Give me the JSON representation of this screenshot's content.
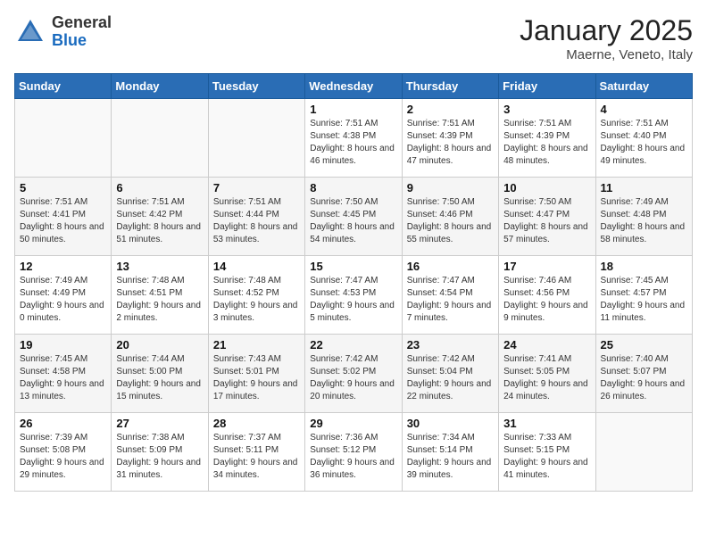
{
  "header": {
    "logo_general": "General",
    "logo_blue": "Blue",
    "title": "January 2025",
    "subtitle": "Maerne, Veneto, Italy"
  },
  "days_of_week": [
    "Sunday",
    "Monday",
    "Tuesday",
    "Wednesday",
    "Thursday",
    "Friday",
    "Saturday"
  ],
  "weeks": [
    [
      {
        "num": "",
        "sunrise": "",
        "sunset": "",
        "daylight": ""
      },
      {
        "num": "",
        "sunrise": "",
        "sunset": "",
        "daylight": ""
      },
      {
        "num": "",
        "sunrise": "",
        "sunset": "",
        "daylight": ""
      },
      {
        "num": "1",
        "sunrise": "Sunrise: 7:51 AM",
        "sunset": "Sunset: 4:38 PM",
        "daylight": "Daylight: 8 hours and 46 minutes."
      },
      {
        "num": "2",
        "sunrise": "Sunrise: 7:51 AM",
        "sunset": "Sunset: 4:39 PM",
        "daylight": "Daylight: 8 hours and 47 minutes."
      },
      {
        "num": "3",
        "sunrise": "Sunrise: 7:51 AM",
        "sunset": "Sunset: 4:39 PM",
        "daylight": "Daylight: 8 hours and 48 minutes."
      },
      {
        "num": "4",
        "sunrise": "Sunrise: 7:51 AM",
        "sunset": "Sunset: 4:40 PM",
        "daylight": "Daylight: 8 hours and 49 minutes."
      }
    ],
    [
      {
        "num": "5",
        "sunrise": "Sunrise: 7:51 AM",
        "sunset": "Sunset: 4:41 PM",
        "daylight": "Daylight: 8 hours and 50 minutes."
      },
      {
        "num": "6",
        "sunrise": "Sunrise: 7:51 AM",
        "sunset": "Sunset: 4:42 PM",
        "daylight": "Daylight: 8 hours and 51 minutes."
      },
      {
        "num": "7",
        "sunrise": "Sunrise: 7:51 AM",
        "sunset": "Sunset: 4:44 PM",
        "daylight": "Daylight: 8 hours and 53 minutes."
      },
      {
        "num": "8",
        "sunrise": "Sunrise: 7:50 AM",
        "sunset": "Sunset: 4:45 PM",
        "daylight": "Daylight: 8 hours and 54 minutes."
      },
      {
        "num": "9",
        "sunrise": "Sunrise: 7:50 AM",
        "sunset": "Sunset: 4:46 PM",
        "daylight": "Daylight: 8 hours and 55 minutes."
      },
      {
        "num": "10",
        "sunrise": "Sunrise: 7:50 AM",
        "sunset": "Sunset: 4:47 PM",
        "daylight": "Daylight: 8 hours and 57 minutes."
      },
      {
        "num": "11",
        "sunrise": "Sunrise: 7:49 AM",
        "sunset": "Sunset: 4:48 PM",
        "daylight": "Daylight: 8 hours and 58 minutes."
      }
    ],
    [
      {
        "num": "12",
        "sunrise": "Sunrise: 7:49 AM",
        "sunset": "Sunset: 4:49 PM",
        "daylight": "Daylight: 9 hours and 0 minutes."
      },
      {
        "num": "13",
        "sunrise": "Sunrise: 7:48 AM",
        "sunset": "Sunset: 4:51 PM",
        "daylight": "Daylight: 9 hours and 2 minutes."
      },
      {
        "num": "14",
        "sunrise": "Sunrise: 7:48 AM",
        "sunset": "Sunset: 4:52 PM",
        "daylight": "Daylight: 9 hours and 3 minutes."
      },
      {
        "num": "15",
        "sunrise": "Sunrise: 7:47 AM",
        "sunset": "Sunset: 4:53 PM",
        "daylight": "Daylight: 9 hours and 5 minutes."
      },
      {
        "num": "16",
        "sunrise": "Sunrise: 7:47 AM",
        "sunset": "Sunset: 4:54 PM",
        "daylight": "Daylight: 9 hours and 7 minutes."
      },
      {
        "num": "17",
        "sunrise": "Sunrise: 7:46 AM",
        "sunset": "Sunset: 4:56 PM",
        "daylight": "Daylight: 9 hours and 9 minutes."
      },
      {
        "num": "18",
        "sunrise": "Sunrise: 7:45 AM",
        "sunset": "Sunset: 4:57 PM",
        "daylight": "Daylight: 9 hours and 11 minutes."
      }
    ],
    [
      {
        "num": "19",
        "sunrise": "Sunrise: 7:45 AM",
        "sunset": "Sunset: 4:58 PM",
        "daylight": "Daylight: 9 hours and 13 minutes."
      },
      {
        "num": "20",
        "sunrise": "Sunrise: 7:44 AM",
        "sunset": "Sunset: 5:00 PM",
        "daylight": "Daylight: 9 hours and 15 minutes."
      },
      {
        "num": "21",
        "sunrise": "Sunrise: 7:43 AM",
        "sunset": "Sunset: 5:01 PM",
        "daylight": "Daylight: 9 hours and 17 minutes."
      },
      {
        "num": "22",
        "sunrise": "Sunrise: 7:42 AM",
        "sunset": "Sunset: 5:02 PM",
        "daylight": "Daylight: 9 hours and 20 minutes."
      },
      {
        "num": "23",
        "sunrise": "Sunrise: 7:42 AM",
        "sunset": "Sunset: 5:04 PM",
        "daylight": "Daylight: 9 hours and 22 minutes."
      },
      {
        "num": "24",
        "sunrise": "Sunrise: 7:41 AM",
        "sunset": "Sunset: 5:05 PM",
        "daylight": "Daylight: 9 hours and 24 minutes."
      },
      {
        "num": "25",
        "sunrise": "Sunrise: 7:40 AM",
        "sunset": "Sunset: 5:07 PM",
        "daylight": "Daylight: 9 hours and 26 minutes."
      }
    ],
    [
      {
        "num": "26",
        "sunrise": "Sunrise: 7:39 AM",
        "sunset": "Sunset: 5:08 PM",
        "daylight": "Daylight: 9 hours and 29 minutes."
      },
      {
        "num": "27",
        "sunrise": "Sunrise: 7:38 AM",
        "sunset": "Sunset: 5:09 PM",
        "daylight": "Daylight: 9 hours and 31 minutes."
      },
      {
        "num": "28",
        "sunrise": "Sunrise: 7:37 AM",
        "sunset": "Sunset: 5:11 PM",
        "daylight": "Daylight: 9 hours and 34 minutes."
      },
      {
        "num": "29",
        "sunrise": "Sunrise: 7:36 AM",
        "sunset": "Sunset: 5:12 PM",
        "daylight": "Daylight: 9 hours and 36 minutes."
      },
      {
        "num": "30",
        "sunrise": "Sunrise: 7:34 AM",
        "sunset": "Sunset: 5:14 PM",
        "daylight": "Daylight: 9 hours and 39 minutes."
      },
      {
        "num": "31",
        "sunrise": "Sunrise: 7:33 AM",
        "sunset": "Sunset: 5:15 PM",
        "daylight": "Daylight: 9 hours and 41 minutes."
      },
      {
        "num": "",
        "sunrise": "",
        "sunset": "",
        "daylight": ""
      }
    ]
  ]
}
